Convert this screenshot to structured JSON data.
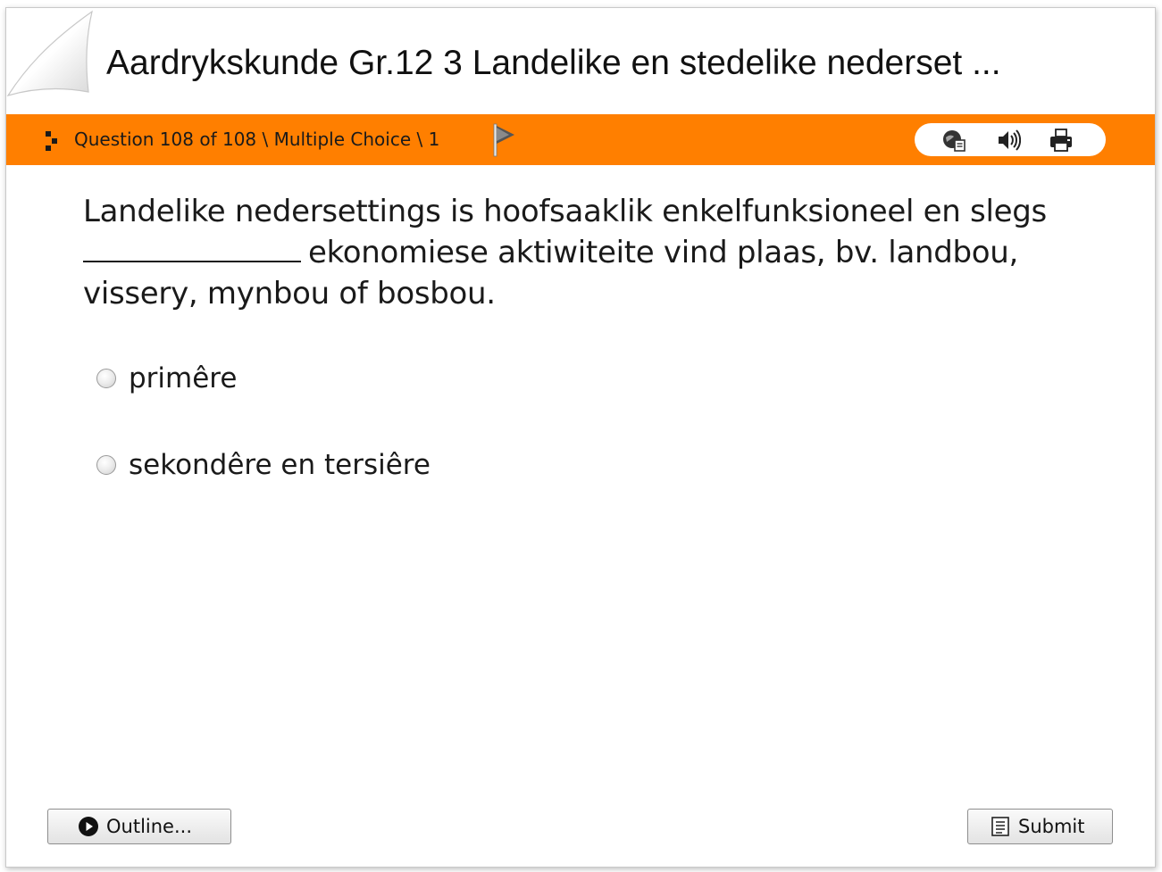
{
  "header": {
    "title": "Aardrykskunde Gr.12 3 Landelike en stedelike nederset ..."
  },
  "toolbar": {
    "question_info": "Question 108 of 108 \\ Multiple Choice \\ 1",
    "icons": [
      "grip-icon",
      "flag-icon",
      "reference-icon",
      "audio-icon",
      "print-icon"
    ],
    "accent_color": "#ff7f00"
  },
  "question": {
    "text_before_blank": "Landelike nedersettings is hoofsaaklik enkelfunksioneel en slegs",
    "text_after_blank": "ekonomiese aktiwiteite vind plaas, bv. landbou, vissery, mynbou of bosbou."
  },
  "choices": [
    {
      "label": "primêre",
      "selected": false
    },
    {
      "label": "sekondêre en tersiêre",
      "selected": false
    }
  ],
  "footer": {
    "outline_label": "Outline...",
    "submit_label": "Submit"
  }
}
